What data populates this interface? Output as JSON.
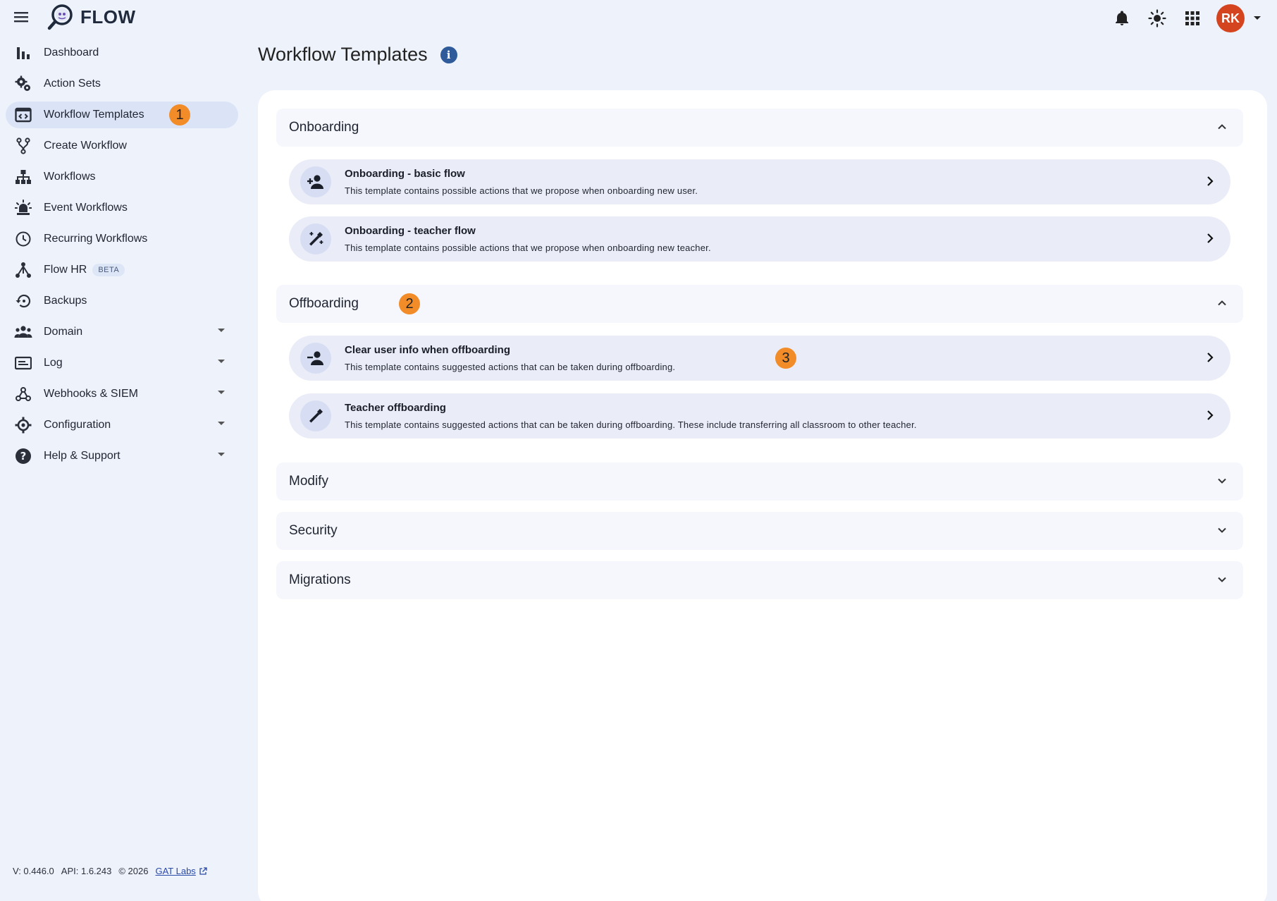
{
  "app": {
    "name": "FLOW"
  },
  "header": {
    "avatar_initials": "RK"
  },
  "sidebar": {
    "items": [
      {
        "label": "Dashboard"
      },
      {
        "label": "Action Sets"
      },
      {
        "label": "Workflow Templates",
        "badge": "1"
      },
      {
        "label": "Create Workflow"
      },
      {
        "label": "Workflows"
      },
      {
        "label": "Event Workflows"
      },
      {
        "label": "Recurring Workflows"
      },
      {
        "label": "Flow HR",
        "tag": "BETA"
      },
      {
        "label": "Backups"
      },
      {
        "label": "Domain"
      },
      {
        "label": "Log"
      },
      {
        "label": "Webhooks & SIEM"
      },
      {
        "label": "Configuration"
      },
      {
        "label": "Help & Support"
      }
    ]
  },
  "footer": {
    "version": "V: 0.446.0",
    "api": "API: 1.6.243",
    "copyright": "© 2026",
    "company": "GAT Labs"
  },
  "page": {
    "title": "Workflow Templates"
  },
  "sections": [
    {
      "title": "Onboarding",
      "templates": [
        {
          "title": "Onboarding - basic flow",
          "description": "This template contains possible actions that we propose when onboarding new user."
        },
        {
          "title": "Onboarding - teacher flow",
          "description": "This template contains possible actions that we propose when onboarding new teacher."
        }
      ]
    },
    {
      "title": "Offboarding",
      "badge": "2",
      "templates": [
        {
          "title": "Clear user info when offboarding",
          "description": "This template contains suggested actions that can be taken during offboarding.",
          "badge": "3"
        },
        {
          "title": "Teacher offboarding",
          "description": "This template contains suggested actions that can be taken during offboarding. These include transferring all classroom to other teacher."
        }
      ]
    },
    {
      "title": "Modify"
    },
    {
      "title": "Security"
    },
    {
      "title": "Migrations"
    }
  ],
  "colors": {
    "accent_badge": "#f28c28",
    "avatar_bg": "#d4451f",
    "active_nav": "#dbe4f7",
    "info_icon": "#2f5b9a"
  }
}
